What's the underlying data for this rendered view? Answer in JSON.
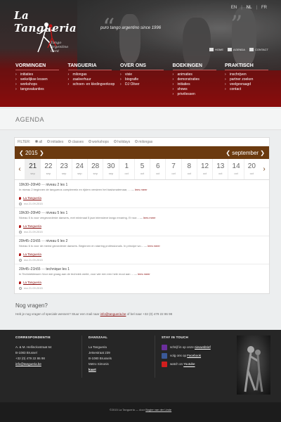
{
  "header": {
    "logo_text": "La Tangueria",
    "logo_sub": [
      "Tango",
      "Argentino",
      "Gent"
    ],
    "tagline": "puro tango argentino since 1996",
    "languages": [
      "EN",
      "NL",
      "FR"
    ],
    "active_language": "NL",
    "icon_links": [
      {
        "label": "HOME",
        "icon": "home-icon"
      },
      {
        "label": "AGENDA",
        "icon": "calendar-icon"
      },
      {
        "label": "CONTACT",
        "icon": "mail-icon"
      }
    ]
  },
  "nav": [
    {
      "title": "VORMINGEN",
      "items": [
        "initiaties",
        "wekelijkse lessen",
        "workshops",
        "tangovakanties"
      ]
    },
    {
      "title": "TANGUERIA",
      "items": [
        "milongas",
        "zaalverhuur",
        "schoen- en kledingverkoop"
      ]
    },
    {
      "title": "OVER ONS",
      "items": [
        "visie",
        "biografie",
        "DJ Oliver"
      ]
    },
    {
      "title": "BOEKINGEN",
      "items": [
        "animaties",
        "demonstraties",
        "initiaties",
        "shows",
        "privélessen"
      ]
    },
    {
      "title": "PRAKTISCH",
      "items": [
        "inschrijven",
        "partner zoeken",
        "veelgevraagd",
        "contact"
      ]
    }
  ],
  "page_title": "AGENDA",
  "filters": {
    "label": "FILTER:",
    "options": [
      {
        "label": "all",
        "checked": true
      },
      {
        "label": "initiaties",
        "checked": false
      },
      {
        "label": "classes",
        "checked": false
      },
      {
        "label": "workshops",
        "checked": false
      },
      {
        "label": "holidays",
        "checked": false
      },
      {
        "label": "milongas",
        "checked": false
      }
    ]
  },
  "calendar": {
    "year_label": "2015",
    "month_label": "september",
    "days": [
      {
        "n": "21",
        "m": "sep",
        "selected": true
      },
      {
        "n": "22",
        "m": "sep"
      },
      {
        "n": "23",
        "m": "sep"
      },
      {
        "n": "24",
        "m": "sep"
      },
      {
        "n": "28",
        "m": "sep"
      },
      {
        "n": "30",
        "m": "sep"
      },
      {
        "n": "1",
        "m": "oct"
      },
      {
        "n": "5",
        "m": "oct"
      },
      {
        "n": "6",
        "m": "oct"
      },
      {
        "n": "7",
        "m": "oct"
      },
      {
        "n": "8",
        "m": "oct"
      },
      {
        "n": "12",
        "m": "oct"
      },
      {
        "n": "13",
        "m": "oct"
      },
      {
        "n": "14",
        "m": "oct"
      },
      {
        "n": "20",
        "m": "oct"
      }
    ]
  },
  "events": [
    {
      "time": "19h30–20h40",
      "title": "niveau 2 les 1",
      "desc": "In niveau 2 beginnen de tangueros compleemtz en rijdem versieen het basismaternaar, ...",
      "more": "lees meer",
      "location": "La Tangueria",
      "date": "ma 21.09.2015"
    },
    {
      "time": "19h30–20h40",
      "title": "niveau 5 les 1",
      "desc": "Niveau 5 is voor vergevorderde dansers, met minimaal 5 jaar intensieve tango ervaring. Er wor...",
      "more": "lees meer",
      "location": "La Tangueria",
      "date": "ma 21.09.2015"
    },
    {
      "time": "20h45–21h55",
      "title": "niveau 6 les 2",
      "desc": "Niveau 6 is voor de meest gevorderde dansers. Beginnen en starring professionals. In principe wo...",
      "more": "lees meer",
      "location": "La Tangueria",
      "date": "ma 21.09.2015"
    },
    {
      "time": "20h45–21h55",
      "title": "technique les 1",
      "desc": "In Technieklessen Voor wie graag aan de techniek werkt, voor wie een een hele mooi aan ...",
      "more": "lees meer",
      "location": "La Tangueria",
      "date": "ma 21.09.2015"
    }
  ],
  "questions": {
    "title": "Nog vragen?",
    "text_before": "Heb je nog vragen of speciale wensen? Stuur een mail naar ",
    "email": "info@tangueria.be",
    "text_after": " of bel naar +32 (0) 479 22 86 98"
  },
  "footer": {
    "correspondentie": {
      "title": "CORRESPONDENTIE",
      "lines": [
        "A. & M. Hellinckxstraat 64",
        "B-1083 Brussel",
        "+32 (0) 479 22 86 98"
      ],
      "email": "info@tangueria.be"
    },
    "danszaal": {
      "title": "DANSZAAL",
      "lines": [
        "La Tangueria",
        "Jetsestraat 239",
        "B-1080 Brussels",
        "Metro Simonis"
      ],
      "map": "kaart"
    },
    "stay": {
      "title": "STAY IN TOUCH",
      "items": [
        {
          "prefix": "schrijf in op onze ",
          "link": "nieuwsbrief",
          "icon": "yahoo-icon",
          "color": "#6b2f9c"
        },
        {
          "prefix": "volg ons op ",
          "link": "Facebook",
          "icon": "facebook-icon",
          "color": "#3b5998"
        },
        {
          "prefix": "watch on ",
          "link": "Youtube",
          "icon": "youtube-icon",
          "color": "#d11e1e"
        }
      ]
    }
  },
  "bottom": {
    "text": "©2015 La Tangueria — door ",
    "link": "Bogier van der Linde"
  }
}
